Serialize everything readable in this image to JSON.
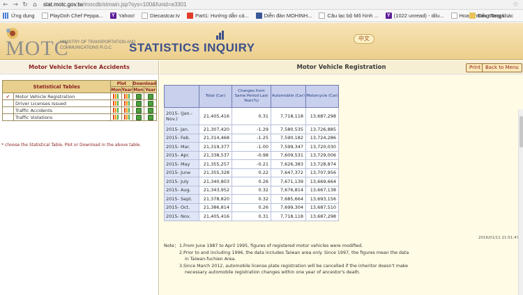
{
  "browser": {
    "url_host": "stat.motc.gov.tw",
    "url_path": "/mocdb/stmain.jsp?sys=100&funid=e3301",
    "bookmarks": [
      {
        "label": "Ứng dụng",
        "icon": "apps-icon"
      },
      {
        "label": "PlayDoh Chef Peppa...",
        "icon": "page-icon"
      },
      {
        "label": "Yahoo!",
        "icon": "yahoo-icon"
      },
      {
        "label": "Diecastcar.tv",
        "icon": "page-icon"
      },
      {
        "label": "Part1: Hướng dẫn cá...",
        "icon": "red-icon"
      },
      {
        "label": "Diễn đàn MOHINH...",
        "icon": "mohinh-icon"
      },
      {
        "label": "Câu lạc bộ Mô hình ...",
        "icon": "page-icon"
      },
      {
        "label": "(1022 unread) - dilu...",
        "icon": "yahoo-icon"
      },
      {
        "label": "Hoasontrang Tangs...",
        "icon": "page-icon"
      }
    ],
    "bookmark_other": "Dấu trang khác"
  },
  "header": {
    "logo": "MOTC",
    "logo_subtext": "MINISTRY OF TRANSPORTATION AND COMMUNICATIONS R.O.C.",
    "title": "STATISTICS INQUIRY",
    "lang_button": "中文"
  },
  "left": {
    "title": "Motor Vehicle Service Accidents",
    "table_header": "Statistical Tables",
    "plot_header": "Plot",
    "download_header": "Download",
    "mon": "Mon",
    "year": "Year",
    "check_mark": "✔",
    "items": [
      {
        "label": "Motor Vehicle Registration",
        "checked": true
      },
      {
        "label": "Driver Licenses Issued",
        "checked": false
      },
      {
        "label": "Traffic Accidents",
        "checked": false
      },
      {
        "label": "Traffic Violations",
        "checked": false
      }
    ],
    "note": "* choose the Statistical Table, Plot or Download in the above table."
  },
  "right": {
    "title": "Motor Vehicle Registration",
    "print_label": "Print",
    "back_label": "Back to Menu",
    "columns": [
      "",
      "Total (Car)",
      "Changes from Same Period Last Year(%)",
      "Automobile (Car)",
      "Motorcycle (Car)"
    ],
    "rows": [
      {
        "period": "2015- (Jan.- Nov.)",
        "total": "21,405,416",
        "change": "0.31",
        "auto": "7,718,118",
        "moto": "13,687,298"
      },
      {
        "period": "2015- Jan.",
        "total": "21,307,420",
        "change": "-1.29",
        "auto": "7,580,535",
        "moto": "13,726,885"
      },
      {
        "period": "2015- Feb.",
        "total": "21,314,468",
        "change": "-1.25",
        "auto": "7,590,182",
        "moto": "13,724,286"
      },
      {
        "period": "2015- Mar.",
        "total": "21,319,377",
        "change": "-1.00",
        "auto": "7,599,347",
        "moto": "13,720,030"
      },
      {
        "period": "2015- Apr.",
        "total": "21,338,537",
        "change": "-0.98",
        "auto": "7,609,531",
        "moto": "13,729,006"
      },
      {
        "period": "2015- May",
        "total": "21,355,257",
        "change": "-0.21",
        "auto": "7,626,383",
        "moto": "13,728,874"
      },
      {
        "period": "2015- June",
        "total": "21,355,328",
        "change": "0.22",
        "auto": "7,647,372",
        "moto": "13,707,956"
      },
      {
        "period": "2015- July",
        "total": "21,340,803",
        "change": "0.26",
        "auto": "7,671,139",
        "moto": "13,669,664"
      },
      {
        "period": "2015- Aug.",
        "total": "21,343,952",
        "change": "0.32",
        "auto": "7,676,814",
        "moto": "13,667,138"
      },
      {
        "period": "2015- Sept.",
        "total": "21,378,820",
        "change": "0.32",
        "auto": "7,685,664",
        "moto": "13,693,156"
      },
      {
        "period": "2015- Oct.",
        "total": "21,386,814",
        "change": "0.26",
        "auto": "7,699,304",
        "moto": "13,687,510"
      },
      {
        "period": "2015- Nov.",
        "total": "21,405,416",
        "change": "0.31",
        "auto": "7,718,118",
        "moto": "13,687,298"
      }
    ],
    "timestamp": "2016/01/11 11:51:47",
    "note_label": "Note：",
    "notes": [
      "1.From June 1987 to April 1995, figures of registered motor vehicles were modified.",
      "2.Prior to and including 1996, the data includes Taiwan area only. Since 1997, the figures mean the data",
      "in Taiwan-fuchien Area.",
      "3.Since March 2012, automobile license plate registration will be cancelled if the inheritor doesn't make",
      "necessary automobile registration changes within one year of ancestor's death."
    ]
  }
}
